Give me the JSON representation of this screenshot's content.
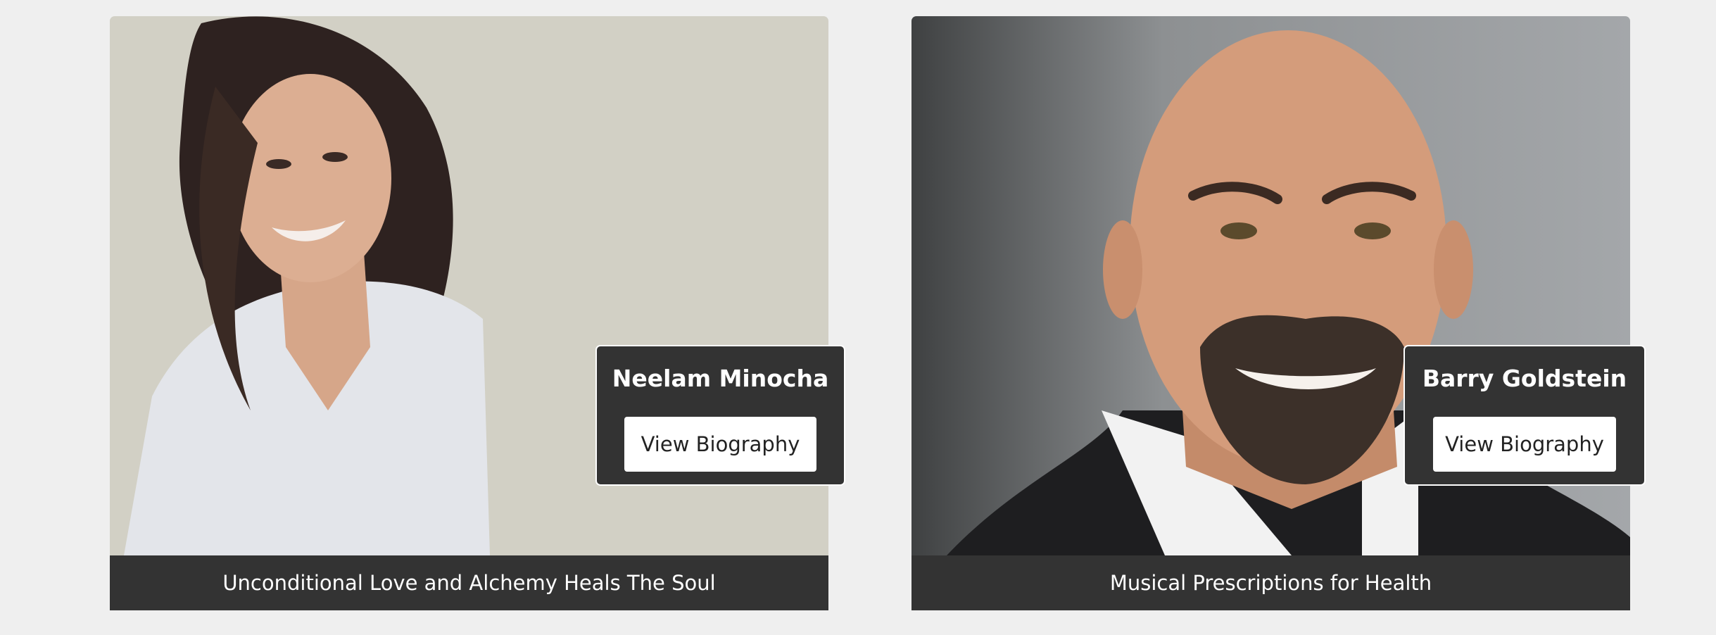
{
  "speakers": [
    {
      "name": "Neelam Minocha",
      "button_label": "View Biography",
      "caption": "Unconditional Love and Alchemy Heals The Soul"
    },
    {
      "name": "Barry Goldstein",
      "button_label": "View Biography",
      "caption": "Musical Prescriptions for Health"
    }
  ],
  "colors": {
    "page_background": "#efefef",
    "panel": "#333333",
    "button_background": "#ffffff",
    "left_photo_background": "#d2d0c5",
    "right_photo_background": "#8c8e92"
  }
}
